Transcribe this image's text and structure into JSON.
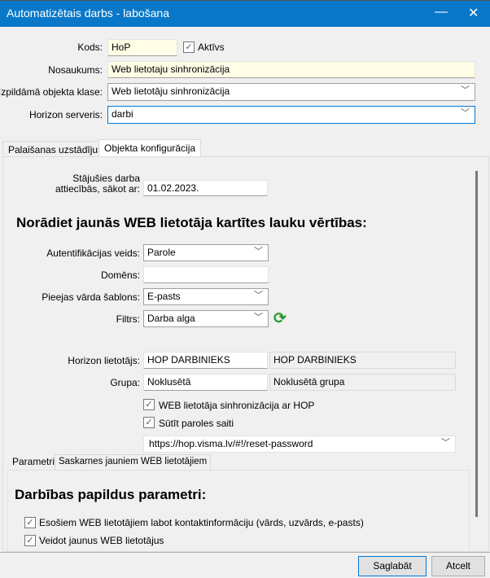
{
  "window": {
    "title": "Automatizētais darbs - labošana",
    "minimize": "—",
    "close": "✕"
  },
  "header": {
    "kods_label": "Kods:",
    "kods_value": "HoP",
    "aktivs_label": "Aktīvs",
    "aktivs_checked": true,
    "nosaukums_label": "Nosaukums:",
    "nosaukums_value": "Web lietotaju sinhronizācija",
    "klase_label": "Izpildāmā objekta klase:",
    "klase_value": "Web lietotāju sinhronizācija",
    "serveris_label": "Horizon serveris:",
    "serveris_value": "darbi"
  },
  "tabs": [
    {
      "label": "Palaišanas uzstādījumi"
    },
    {
      "label": "Objekta konfigurācija",
      "active": true
    }
  ],
  "config": {
    "stajusies_label_1": "Stājušies darba",
    "stajusies_label_2": "attiecībās, sākot ar:",
    "stajusies_value": "01.02.2023.",
    "heading": "Norādiet jaunās WEB lietotāja kartītes lauku vērtības:",
    "auth_label": "Autentifikācijas veids:",
    "auth_value": "Parole",
    "domens_label": "Domēns:",
    "domens_value": "",
    "sablons_label": "Pieejas vārda šablons:",
    "sablons_value": "E-pasts",
    "filtrs_label": "Filtrs:",
    "filtrs_value": "Darba alga",
    "lietotajs_label": "Horizon lietotājs:",
    "lietotajs_value": "HOP DARBINIEKS",
    "lietotajs_name": "HOP DARBINIEKS",
    "grupa_label": "Grupa:",
    "grupa_value": "Noklusētā",
    "grupa_name": "Noklusētā grupa",
    "sync_label": "WEB lietotāja sinhronizācija ar HOP",
    "sync_checked": true,
    "send_label": "Sūtīt paroles saiti",
    "send_checked": true,
    "url_value": "https://hop.visma.lv/#!/reset-password"
  },
  "subtabs": [
    {
      "label": "Parametri",
      "active": true
    },
    {
      "label": "Saskarnes jauniem WEB lietotājiem"
    }
  ],
  "params": {
    "heading": "Darbības papildus parametri:",
    "opt1": "Esošiem WEB lietotājiem labot kontaktinformāciju (vārds, uzvārds, e-pasts)",
    "opt1_checked": true,
    "opt2": "Veidot jaunus WEB lietotājus",
    "opt2_checked": true
  },
  "footer": {
    "save": "Saglabāt",
    "cancel": "Atcelt"
  },
  "icons": {
    "check": "✓",
    "chevron": "﹀",
    "refresh": "⟳"
  }
}
